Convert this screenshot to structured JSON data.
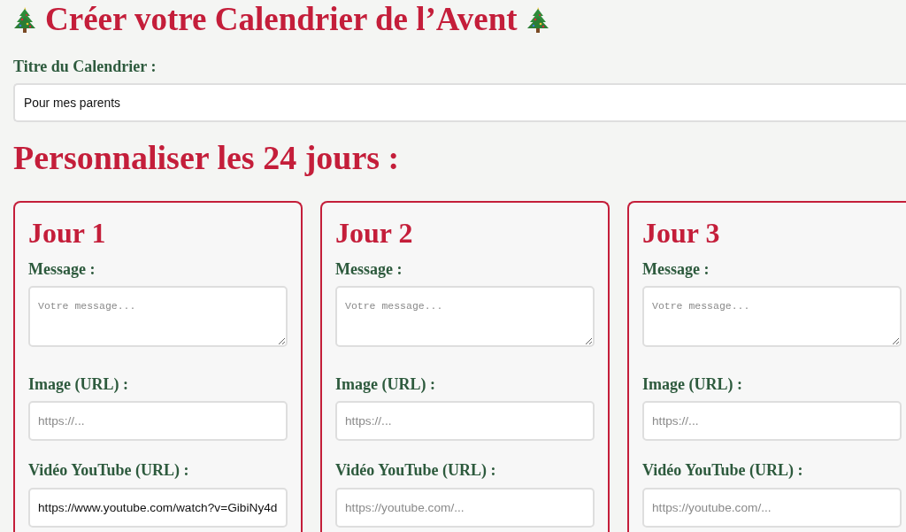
{
  "header": {
    "title": "Créer votre Calendrier de l’Avent"
  },
  "calendar_title": {
    "label": "Titre du Calendrier :",
    "value": "Pour mes parents"
  },
  "section_heading": "Personnaliser les 24 jours :",
  "days": [
    {
      "title": "Jour 1",
      "fields": [
        {
          "kind": "textarea",
          "label": "Message :",
          "placeholder": "Votre message..."
        },
        {
          "kind": "url",
          "label": "Image (URL) :",
          "placeholder": "https://..."
        },
        {
          "kind": "url",
          "label": "Vidéo YouTube (URL) :",
          "value": "https://www.youtube.com/watch?v=GibiNy4d"
        }
      ]
    },
    {
      "title": "Jour 2",
      "fields": [
        {
          "kind": "textarea",
          "label": "Message :",
          "placeholder": "Votre message..."
        },
        {
          "kind": "url",
          "label": "Image (URL) :",
          "placeholder": "https://..."
        },
        {
          "kind": "url",
          "label": "Vidéo YouTube (URL) :",
          "placeholder": "https://youtube.com/..."
        }
      ]
    },
    {
      "title": "Jour 3",
      "fields": [
        {
          "kind": "textarea",
          "label": "Message :",
          "placeholder": "Votre message..."
        },
        {
          "kind": "url",
          "label": "Image (URL) :",
          "placeholder": "https://..."
        },
        {
          "kind": "url",
          "label": "Vidéo YouTube (URL) :",
          "placeholder": "https://youtube.com/..."
        }
      ]
    }
  ]
}
